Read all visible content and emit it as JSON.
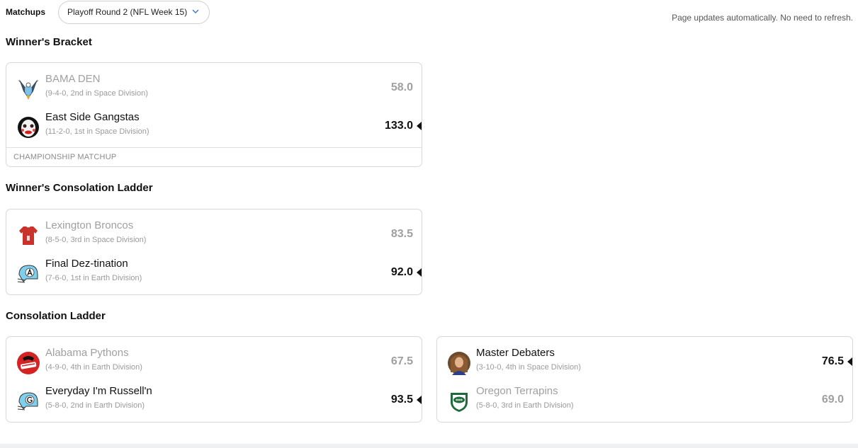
{
  "header": {
    "matchups_label": "Matchups",
    "week_select": {
      "selected": "Playoff Round 2 (NFL Week 15)"
    },
    "auto_update_note": "Page updates automatically. No need to refresh."
  },
  "sections": {
    "winners_bracket": {
      "title": "Winner's Bracket",
      "matchup": {
        "footer": "CHAMPIONSHIP MATCHUP",
        "team1": {
          "name": "BAMA DEN",
          "record": "(9-4-0, 2nd in Space Division)",
          "score": "58.0",
          "avatar": "eagle-logo-icon"
        },
        "team2": {
          "name": "East Side Gangstas",
          "record": "(11-2-0, 1st in Space Division)",
          "score": "133.0",
          "avatar": "clown-mask-icon"
        }
      }
    },
    "winners_consolation": {
      "title": "Winner's Consolation Ladder",
      "matchup": {
        "team1": {
          "name": "Lexington Broncos",
          "record": "(8-5-0, 3rd in Space Division)",
          "score": "83.5",
          "avatar": "jersey-icon"
        },
        "team2": {
          "name": "Final Dez-tination",
          "record": "(7-6-0, 1st in Earth Division)",
          "score": "92.0",
          "avatar": "helmet-a-icon"
        }
      }
    },
    "consolation": {
      "title": "Consolation Ladder",
      "matchup1": {
        "team1": {
          "name": "Alabama Pythons",
          "record": "(4-9-0, 4th in Earth Division)",
          "score": "67.5",
          "avatar": "pythons-logo-icon"
        },
        "team2": {
          "name": "Everyday I'm Russell'n",
          "record": "(5-8-0, 2nd in Earth Division)",
          "score": "93.5",
          "avatar": "helmet-g-icon"
        }
      },
      "matchup2": {
        "team1": {
          "name": "Master Debaters",
          "record": "(3-10-0, 4th in Space Division)",
          "score": "76.5",
          "avatar": "portrait-icon"
        },
        "team2": {
          "name": "Oregon Terrapins",
          "record": "(5-8-0, 3rd in Earth Division)",
          "score": "69.0",
          "avatar": "football-shield-icon"
        }
      }
    }
  },
  "colors": {
    "winner_text": "#111111",
    "loser_text": "#a0a0a0",
    "record_text": "#9a9a9a",
    "border": "#d8d8d8"
  }
}
